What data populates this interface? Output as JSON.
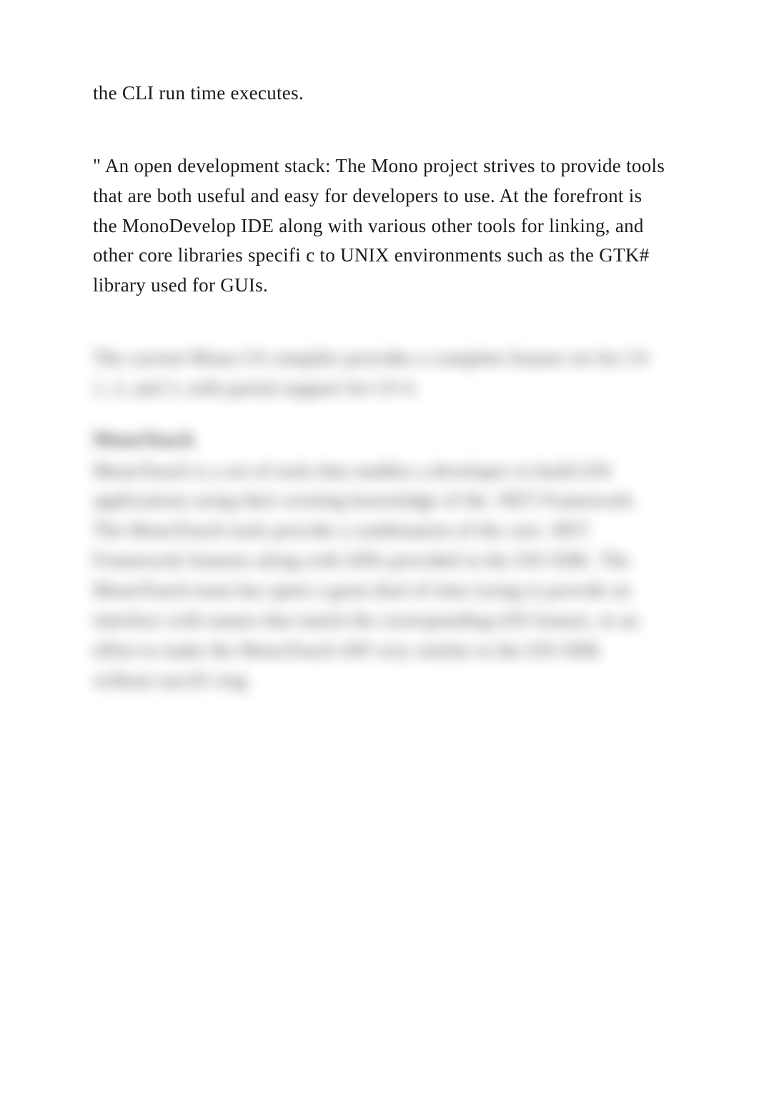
{
  "para1": "the CLI run time executes.",
  "para2": " \" An open development stack: The Mono project strives to provide tools that are both useful and easy for developers to use. At the forefront is the MonoDevelop IDE along with various other tools for linking, and other core libraries specifi c to UNIX environments such as the GTK# library used for GUIs.",
  "blurred": {
    "para3": "The current Mono C# compiler provides a complete feature set for C# 1, 2, and 3, with partial support for C# 4.",
    "heading": "MonoTouch",
    "para4": "MonoTouch is a set of tools that enables a developer to build iOS applications using their existing knowledge of the .NET Framework. The MonoTouch tools provide a combination of the core .NET Framework features along with APIs provided in the iOS SDK. The MonoTouch team has spent a great deal of time trying to provide an interface with names that match the corresponding iOS feature, in an effort to make the MonoTouch API very similar to the iOS SDK without sacrifi cing"
  }
}
